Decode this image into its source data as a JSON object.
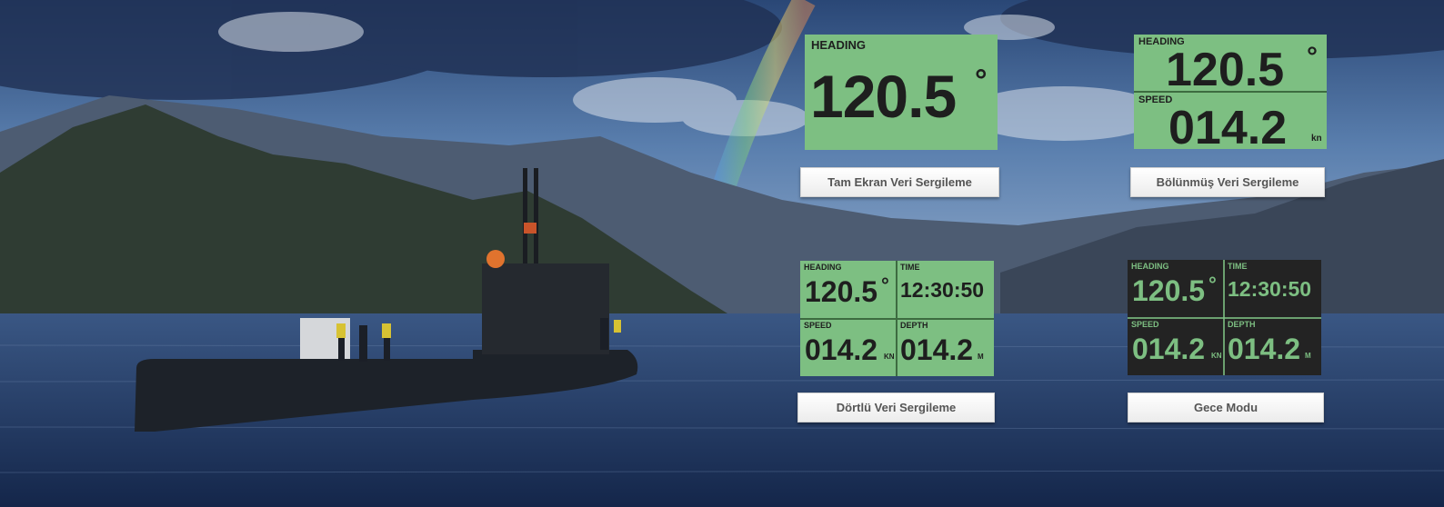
{
  "full_display": {
    "label": "HEADING",
    "value": "120.5",
    "unit": "°"
  },
  "split_display": {
    "top": {
      "label": "HEADING",
      "value": "120.5",
      "unit": "°"
    },
    "bottom": {
      "label": "SPEED",
      "value": "014.2",
      "unit": "kn"
    }
  },
  "quad_display": {
    "heading": {
      "label": "HEADING",
      "value": "120.5",
      "unit": "°"
    },
    "time": {
      "label": "TIME",
      "value": "12:30:50"
    },
    "speed": {
      "label": "SPEED",
      "value": "014.2",
      "unit": "KN"
    },
    "depth": {
      "label": "DEPTH",
      "value": "014.2",
      "unit": "M"
    }
  },
  "night_display": {
    "heading": {
      "label": "HEADING",
      "value": "120.5",
      "unit": "°"
    },
    "time": {
      "label": "TIME",
      "value": "12:30:50"
    },
    "speed": {
      "label": "SPEED",
      "value": "014.2",
      "unit": "KN"
    },
    "depth": {
      "label": "DEPTH",
      "value": "014.2",
      "unit": "M"
    }
  },
  "buttons": {
    "full": "Tam Ekran Veri Sergileme",
    "split": "Bölünmüş Veri Sergileme",
    "quad": "Dörtlü Veri Sergileme",
    "night": "Gece Modu"
  },
  "colors": {
    "display_green": "#7dbf82",
    "display_dark": "#232323",
    "display_text": "#1e1e1e"
  }
}
